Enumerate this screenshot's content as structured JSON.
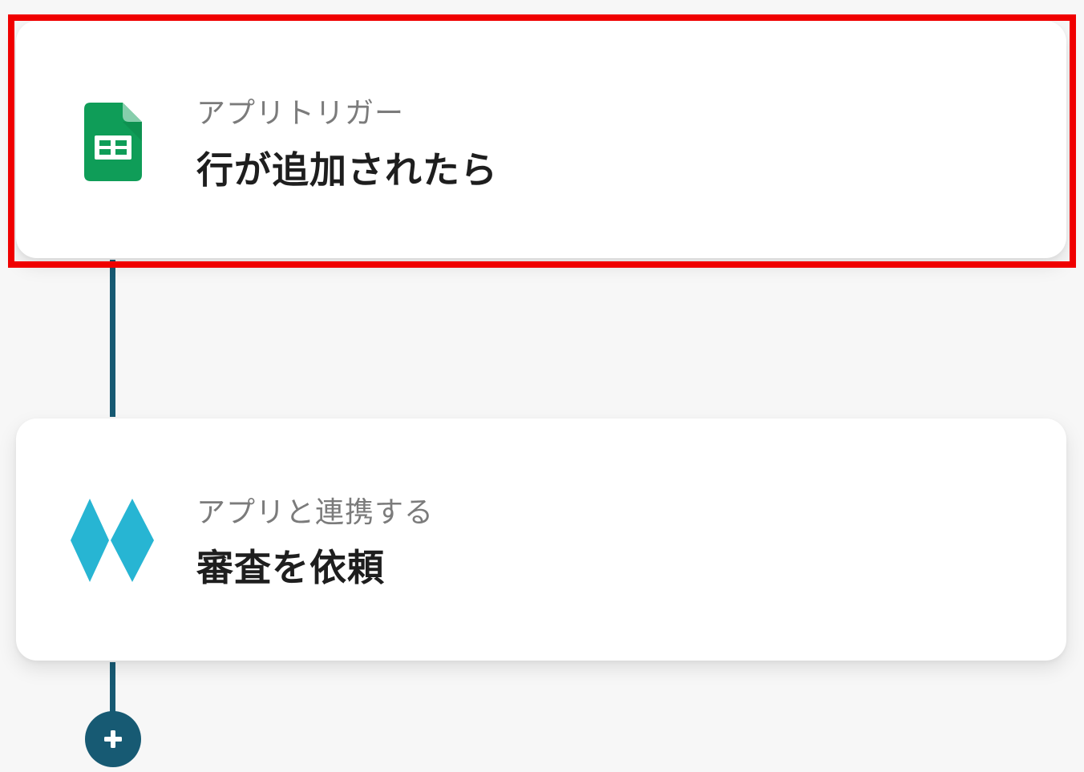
{
  "flow": {
    "steps": [
      {
        "sublabel": "アプリトリガー",
        "title": "行が追加されたら",
        "icon": "google-sheets-icon",
        "highlighted": true
      },
      {
        "sublabel": "アプリと連携する",
        "title": "審査を依頼",
        "icon": "diamond-app-icon",
        "highlighted": false
      }
    ],
    "add_step_icon": "plus-icon"
  },
  "colors": {
    "background": "#f7f7f7",
    "card": "#ffffff",
    "highlight": "#f00000",
    "connector": "#175a73",
    "sheets_green": "#0f9d58",
    "diamond_blue": "#27b5d3",
    "sublabel": "#7b7b7b",
    "title": "#1e1e1e"
  }
}
